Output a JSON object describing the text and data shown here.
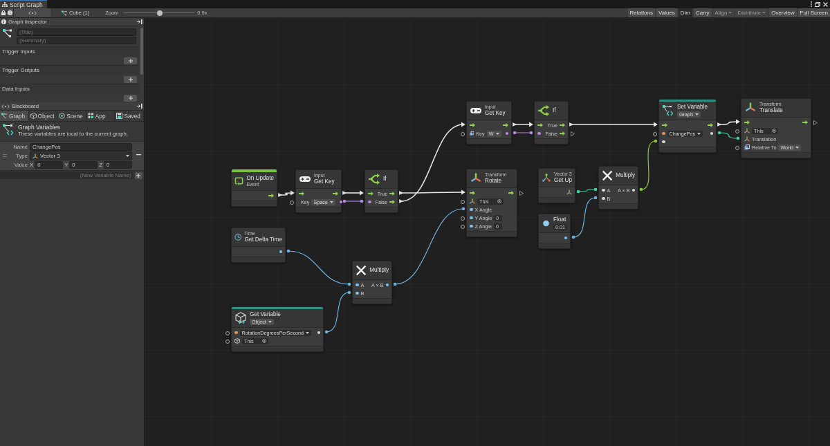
{
  "window": {
    "title": "Script Graph"
  },
  "toolbar": {
    "target": "Cube (1)",
    "zoom_label": "Zoom",
    "zoom": {
      "level": 0.5
    },
    "zoom_reading": "0.9x",
    "buttons": [
      {
        "label": "Relations",
        "kind": "toggle",
        "on": false,
        "disabled": false
      },
      {
        "label": "Values",
        "kind": "toggle",
        "on": false,
        "disabled": false
      },
      {
        "label": "Dim",
        "kind": "toggle",
        "on": true,
        "disabled": false
      },
      {
        "label": "Carry",
        "kind": "toggle",
        "on": false,
        "disabled": false
      },
      {
        "label": "Align",
        "kind": "dropdown",
        "on": false,
        "disabled": true
      },
      {
        "label": "Distribute",
        "kind": "dropdown",
        "on": false,
        "disabled": true
      },
      {
        "label": "Overview",
        "kind": "button",
        "on": false,
        "disabled": false
      },
      {
        "label": "Full Screen",
        "kind": "button",
        "on": false,
        "disabled": false
      }
    ]
  },
  "graph_inspector": {
    "title": "Graph Inspector",
    "title_placeholder": "(Title)",
    "summary_placeholder": "(Summary)",
    "sections": [
      "Trigger Inputs",
      "Trigger Outputs",
      "Data Inputs"
    ]
  },
  "blackboard": {
    "title": "Blackboard",
    "tabs": [
      {
        "label": "Graph",
        "kind": "graph",
        "selected": true
      },
      {
        "label": "Object",
        "kind": "object",
        "selected": false
      },
      {
        "label": "Scene",
        "kind": "scene",
        "selected": false
      },
      {
        "label": "App",
        "kind": "app",
        "selected": false
      },
      {
        "label": "Saved",
        "kind": "saved",
        "selected": false
      }
    ],
    "heading": "Graph Variables",
    "description": "These variables are local to the current graph.",
    "variable": {
      "name_label": "Name",
      "name": "ChangePos",
      "type_label": "Type",
      "type": "Vector 3",
      "value_label": "Value",
      "components": [
        {
          "axis": "X",
          "value": "0"
        },
        {
          "axis": "Y",
          "value": "0"
        },
        {
          "axis": "Z",
          "value": "0"
        }
      ]
    },
    "new_variable_placeholder": "(New Variable Name)"
  },
  "nodes": [
    {
      "kind": "event",
      "title": "On Update",
      "subtitle": "Event",
      "rows": [
        {
          "out": {
            "kind": "flow",
            "open": false
          }
        }
      ]
    },
    {
      "kind": "input",
      "category": "Input",
      "title": "Get Key",
      "rows": [
        {
          "in": {
            "kind": "flow",
            "open": false
          },
          "out": {
            "kind": "flow",
            "open": false
          }
        },
        {
          "in": {
            "kind": "enum",
            "open": true
          },
          "label": "Key",
          "dropdown": "Space",
          "out": {
            "kind": "bool",
            "open": false
          }
        }
      ]
    },
    {
      "kind": "branch",
      "title": "If",
      "rows": [
        {
          "in": {
            "kind": "flow",
            "open": false
          },
          "out_label": "True",
          "out": {
            "kind": "flow",
            "open": false
          }
        },
        {
          "in": {
            "kind": "bool",
            "open": false
          },
          "out_label": "False",
          "out": {
            "kind": "flow",
            "open": false
          }
        }
      ]
    },
    {
      "kind": "input",
      "category": "Input",
      "title": "Get Key",
      "rows": [
        {
          "in": {
            "kind": "flow",
            "open": false
          },
          "out": {
            "kind": "flow",
            "open": false
          }
        },
        {
          "in": {
            "kind": "enum",
            "open": true
          },
          "label": "Key",
          "dropdown": "W",
          "out": {
            "kind": "bool",
            "open": false
          }
        }
      ]
    },
    {
      "kind": "branch",
      "title": "If",
      "rows": [
        {
          "in": {
            "kind": "flow",
            "open": false
          },
          "out_label": "True",
          "out": {
            "kind": "flow",
            "open": false
          }
        },
        {
          "in": {
            "kind": "bool",
            "open": false
          },
          "out_label": "False",
          "out": {
            "kind": "flow",
            "open": true
          }
        }
      ]
    },
    {
      "kind": "set_variable",
      "title": "Set Variable",
      "header_dropdown": "Graph",
      "rows": [
        {
          "in": {
            "kind": "flow",
            "open": false
          },
          "out": {
            "kind": "flow",
            "open": false
          }
        },
        {
          "in": {
            "kind": "string",
            "open": true
          },
          "dropdown": "ChangePos",
          "out": {
            "kind": "any",
            "open": false
          }
        },
        {
          "in": {
            "kind": "any",
            "open": false
          }
        }
      ]
    },
    {
      "kind": "transform",
      "category": "Transform",
      "title": "Translate",
      "rows": [
        {
          "in": {
            "kind": "flow",
            "open": false
          },
          "out": {
            "kind": "flow",
            "open": true
          }
        },
        {
          "in": {
            "kind": "transform",
            "open": true
          },
          "field": "This"
        },
        {
          "in": {
            "kind": "vector",
            "open": false
          },
          "label": "Translation"
        },
        {
          "in": {
            "kind": "enum",
            "open": true
          },
          "label": "Relative To",
          "dropdown": "World"
        }
      ]
    },
    {
      "kind": "transform",
      "category": "Transform",
      "title": "Rotate",
      "rows": [
        {
          "in": {
            "kind": "flow",
            "open": false
          },
          "out": {
            "kind": "flow",
            "open": true
          }
        },
        {
          "in": {
            "kind": "transform",
            "open": true
          },
          "field": "This"
        },
        {
          "in": {
            "kind": "float",
            "open": false
          },
          "label": "X Angle"
        },
        {
          "in": {
            "kind": "float",
            "open": true
          },
          "label": "Y Angle",
          "field": "0"
        },
        {
          "in": {
            "kind": "float",
            "open": true
          },
          "label": "Z Angle",
          "field": "0"
        }
      ]
    },
    {
      "kind": "vector",
      "category": "Vector 3",
      "title": "Get Up",
      "rows": [
        {
          "out": {
            "kind": "vector",
            "open": false
          }
        }
      ]
    },
    {
      "kind": "multiply",
      "title": "Multiply",
      "rows": [
        {
          "in": {
            "kind": "any",
            "open": false
          },
          "label": "A",
          "out_label": "A × B",
          "out": {
            "kind": "any",
            "open": false
          }
        },
        {
          "in": {
            "kind": "any",
            "open": false
          },
          "label": "B"
        }
      ]
    },
    {
      "kind": "literal",
      "title": "Float",
      "header_field": "0.01",
      "rows": [
        {
          "out": {
            "kind": "float",
            "open": false
          }
        }
      ]
    },
    {
      "kind": "time",
      "category": "Time",
      "title": "Get Delta Time",
      "rows": [
        {
          "out": {
            "kind": "float",
            "open": false
          }
        }
      ]
    },
    {
      "kind": "multiply",
      "title": "Multiply",
      "rows": [
        {
          "in": {
            "kind": "float",
            "open": false
          },
          "label": "A",
          "out_label": "A × B",
          "out": {
            "kind": "float",
            "open": false
          }
        },
        {
          "in": {
            "kind": "float",
            "open": false
          },
          "label": "B"
        }
      ]
    },
    {
      "kind": "get_variable",
      "title": "Get Variable",
      "header_dropdown": "Object",
      "rows": [
        {
          "in": {
            "kind": "string",
            "open": true
          },
          "dropdown": "RotationDegreesPerSecond",
          "out": {
            "kind": "any",
            "open": false
          }
        },
        {
          "in": {
            "kind": "gameobject",
            "open": true
          },
          "field": "This"
        }
      ]
    }
  ]
}
